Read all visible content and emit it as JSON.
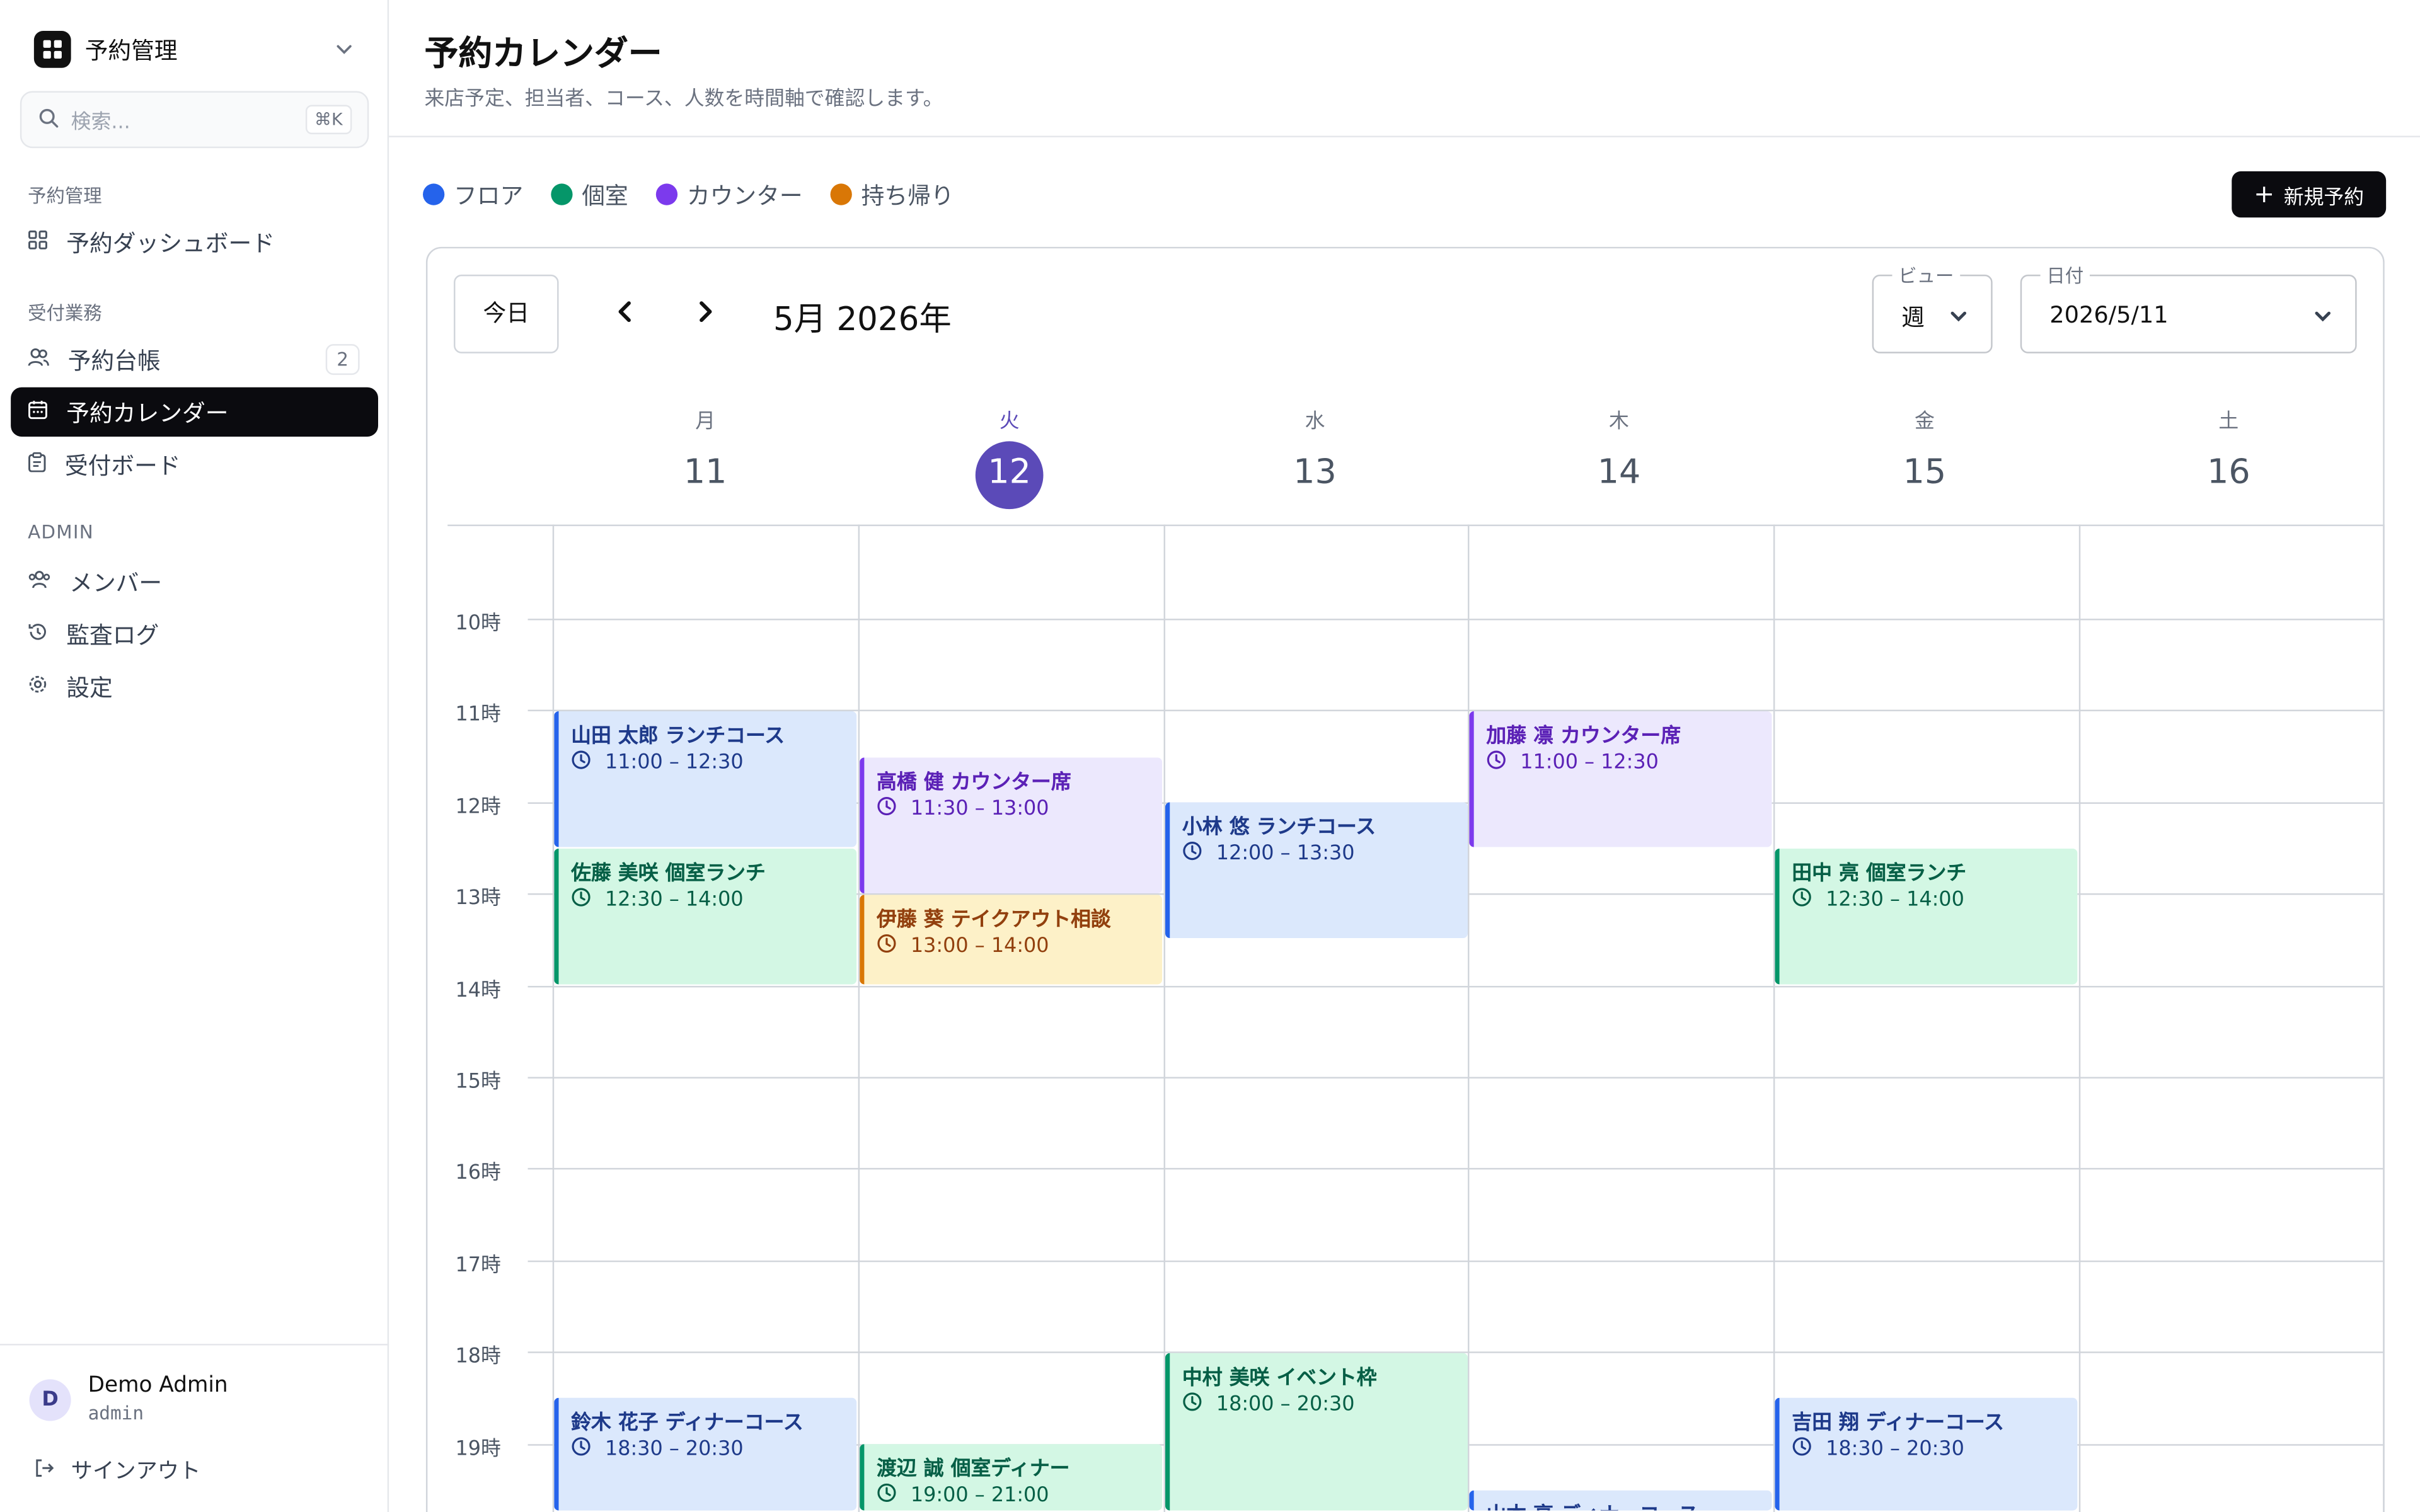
{
  "workspace": {
    "name": "予約管理"
  },
  "search": {
    "placeholder": "検索...",
    "shortcut": "⌘K"
  },
  "sidebar": {
    "sections": [
      {
        "title": "予約管理",
        "items": [
          {
            "label": "予約ダッシュボード",
            "icon": "grid-icon"
          }
        ]
      },
      {
        "title": "受付業務",
        "items": [
          {
            "label": "予約台帳",
            "icon": "users-icon",
            "badge": "2"
          },
          {
            "label": "予約カレンダー",
            "icon": "calendar-icon",
            "active": true
          },
          {
            "label": "受付ボード",
            "icon": "clipboard-icon"
          }
        ]
      },
      {
        "title": "ADMIN",
        "items": [
          {
            "label": "メンバー",
            "icon": "members-icon"
          },
          {
            "label": "監査ログ",
            "icon": "history-icon"
          },
          {
            "label": "設定",
            "icon": "gear-icon"
          }
        ]
      }
    ]
  },
  "user": {
    "initial": "D",
    "name": "Demo Admin",
    "role": "admin",
    "signout": "サインアウト"
  },
  "page": {
    "title": "予約カレンダー",
    "subtitle": "来店予定、担当者、コース、人数を時間軸で確認します。"
  },
  "legend": [
    {
      "label": "フロア",
      "color": "#2563eb"
    },
    {
      "label": "個室",
      "color": "#059669"
    },
    {
      "label": "カウンター",
      "color": "#7c3aed"
    },
    {
      "label": "持ち帰り",
      "color": "#d97706"
    }
  ],
  "actions": {
    "new_reservation": "新規予約"
  },
  "calendar": {
    "today_button": "今日",
    "title": "5月 2026年",
    "view": {
      "label": "ビュー",
      "value": "週"
    },
    "date": {
      "label": "日付",
      "value": "2026/5/11"
    },
    "days": [
      {
        "dow": "月",
        "num": "11"
      },
      {
        "dow": "火",
        "num": "12",
        "today": true
      },
      {
        "dow": "水",
        "num": "13"
      },
      {
        "dow": "木",
        "num": "14"
      },
      {
        "dow": "金",
        "num": "15"
      },
      {
        "dow": "土",
        "num": "16"
      }
    ],
    "hours": [
      "10時",
      "11時",
      "12時",
      "13時",
      "14時",
      "15時",
      "16時",
      "17時",
      "18時",
      "19時"
    ],
    "events": [
      {
        "day": 0,
        "start": "11:00",
        "end": "12:30",
        "type": "floor",
        "title": "山田 太郎 ランチコース",
        "time": "11:00 – 12:30"
      },
      {
        "day": 0,
        "start": "12:30",
        "end": "14:00",
        "type": "private",
        "title": "佐藤 美咲 個室ランチ",
        "time": "12:30 – 14:00"
      },
      {
        "day": 0,
        "start": "18:30",
        "end": "20:30",
        "type": "floor",
        "title": "鈴木 花子 ディナーコース",
        "time": "18:30 – 20:30"
      },
      {
        "day": 1,
        "start": "11:30",
        "end": "13:00",
        "type": "counter",
        "title": "高橋 健 カウンター席",
        "time": "11:30 – 13:00"
      },
      {
        "day": 1,
        "start": "13:00",
        "end": "14:00",
        "type": "takeout",
        "title": "伊藤 葵 テイクアウト相談",
        "time": "13:00 – 14:00"
      },
      {
        "day": 1,
        "start": "19:00",
        "end": "21:00",
        "type": "private",
        "title": "渡辺 誠 個室ディナー",
        "time": "19:00 – 21:00"
      },
      {
        "day": 2,
        "start": "12:00",
        "end": "13:30",
        "type": "floor",
        "title": "小林 悠 ランチコース",
        "time": "12:00 – 13:30"
      },
      {
        "day": 2,
        "start": "18:00",
        "end": "20:30",
        "type": "private",
        "title": "中村 美咲 イベント枠",
        "time": "18:00 – 20:30"
      },
      {
        "day": 3,
        "start": "11:00",
        "end": "12:30",
        "type": "counter",
        "title": "加藤 凛 カウンター席",
        "time": "11:00 – 12:30"
      },
      {
        "day": 3,
        "start": "19:30",
        "end": "21:30",
        "type": "floor",
        "title": "山本 亮 ディナーコース",
        "time": ""
      },
      {
        "day": 4,
        "start": "12:30",
        "end": "14:00",
        "type": "private",
        "title": "田中 亮 個室ランチ",
        "time": "12:30 – 14:00"
      },
      {
        "day": 4,
        "start": "18:30",
        "end": "20:30",
        "type": "floor",
        "title": "吉田 翔 ディナーコース",
        "time": "18:30 – 20:30"
      }
    ]
  }
}
